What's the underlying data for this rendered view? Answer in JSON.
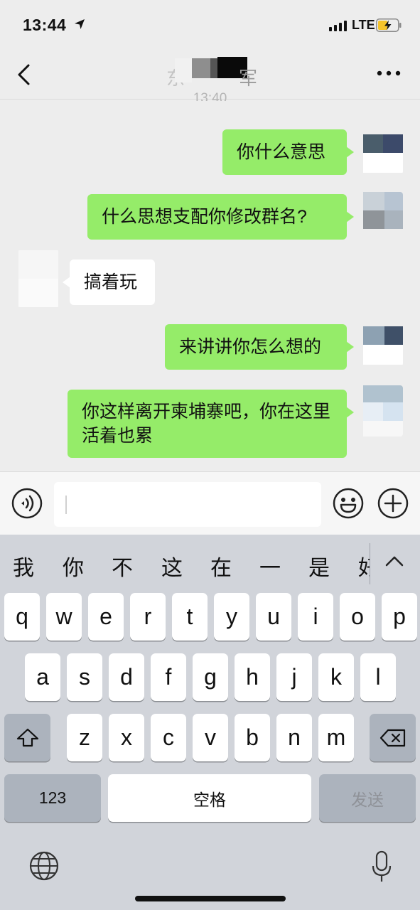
{
  "status": {
    "time": "13:44",
    "network": "LTE"
  },
  "nav": {
    "title": "东",
    "title_tail": "军"
  },
  "chat": {
    "time_separator": "13:40",
    "messages": [
      {
        "direction": "out",
        "text": "你什么意思"
      },
      {
        "direction": "out",
        "text": "什么思想支配你修改群名?"
      },
      {
        "direction": "in",
        "text": "搞着玩"
      },
      {
        "direction": "out",
        "text": "来讲讲你怎么想的"
      },
      {
        "direction": "out",
        "text": "你这样离开柬埔寨吧，你在这里活着也累"
      }
    ]
  },
  "input": {
    "value": ""
  },
  "keyboard": {
    "candidates": [
      "我",
      "你",
      "不",
      "这",
      "在",
      "一",
      "是",
      "好"
    ],
    "row1": [
      "q",
      "w",
      "e",
      "r",
      "t",
      "y",
      "u",
      "i",
      "o",
      "p"
    ],
    "row2": [
      "a",
      "s",
      "d",
      "f",
      "g",
      "h",
      "j",
      "k",
      "l"
    ],
    "row3": [
      "z",
      "x",
      "c",
      "v",
      "b",
      "n",
      "m"
    ],
    "numbers_label": "123",
    "space_label": "空格",
    "send_label": "发送"
  },
  "colors": {
    "outgoing_bubble": "#95ec69",
    "incoming_bubble": "#ffffff",
    "chat_background": "#ededed",
    "keyboard_background": "#d1d4da"
  }
}
